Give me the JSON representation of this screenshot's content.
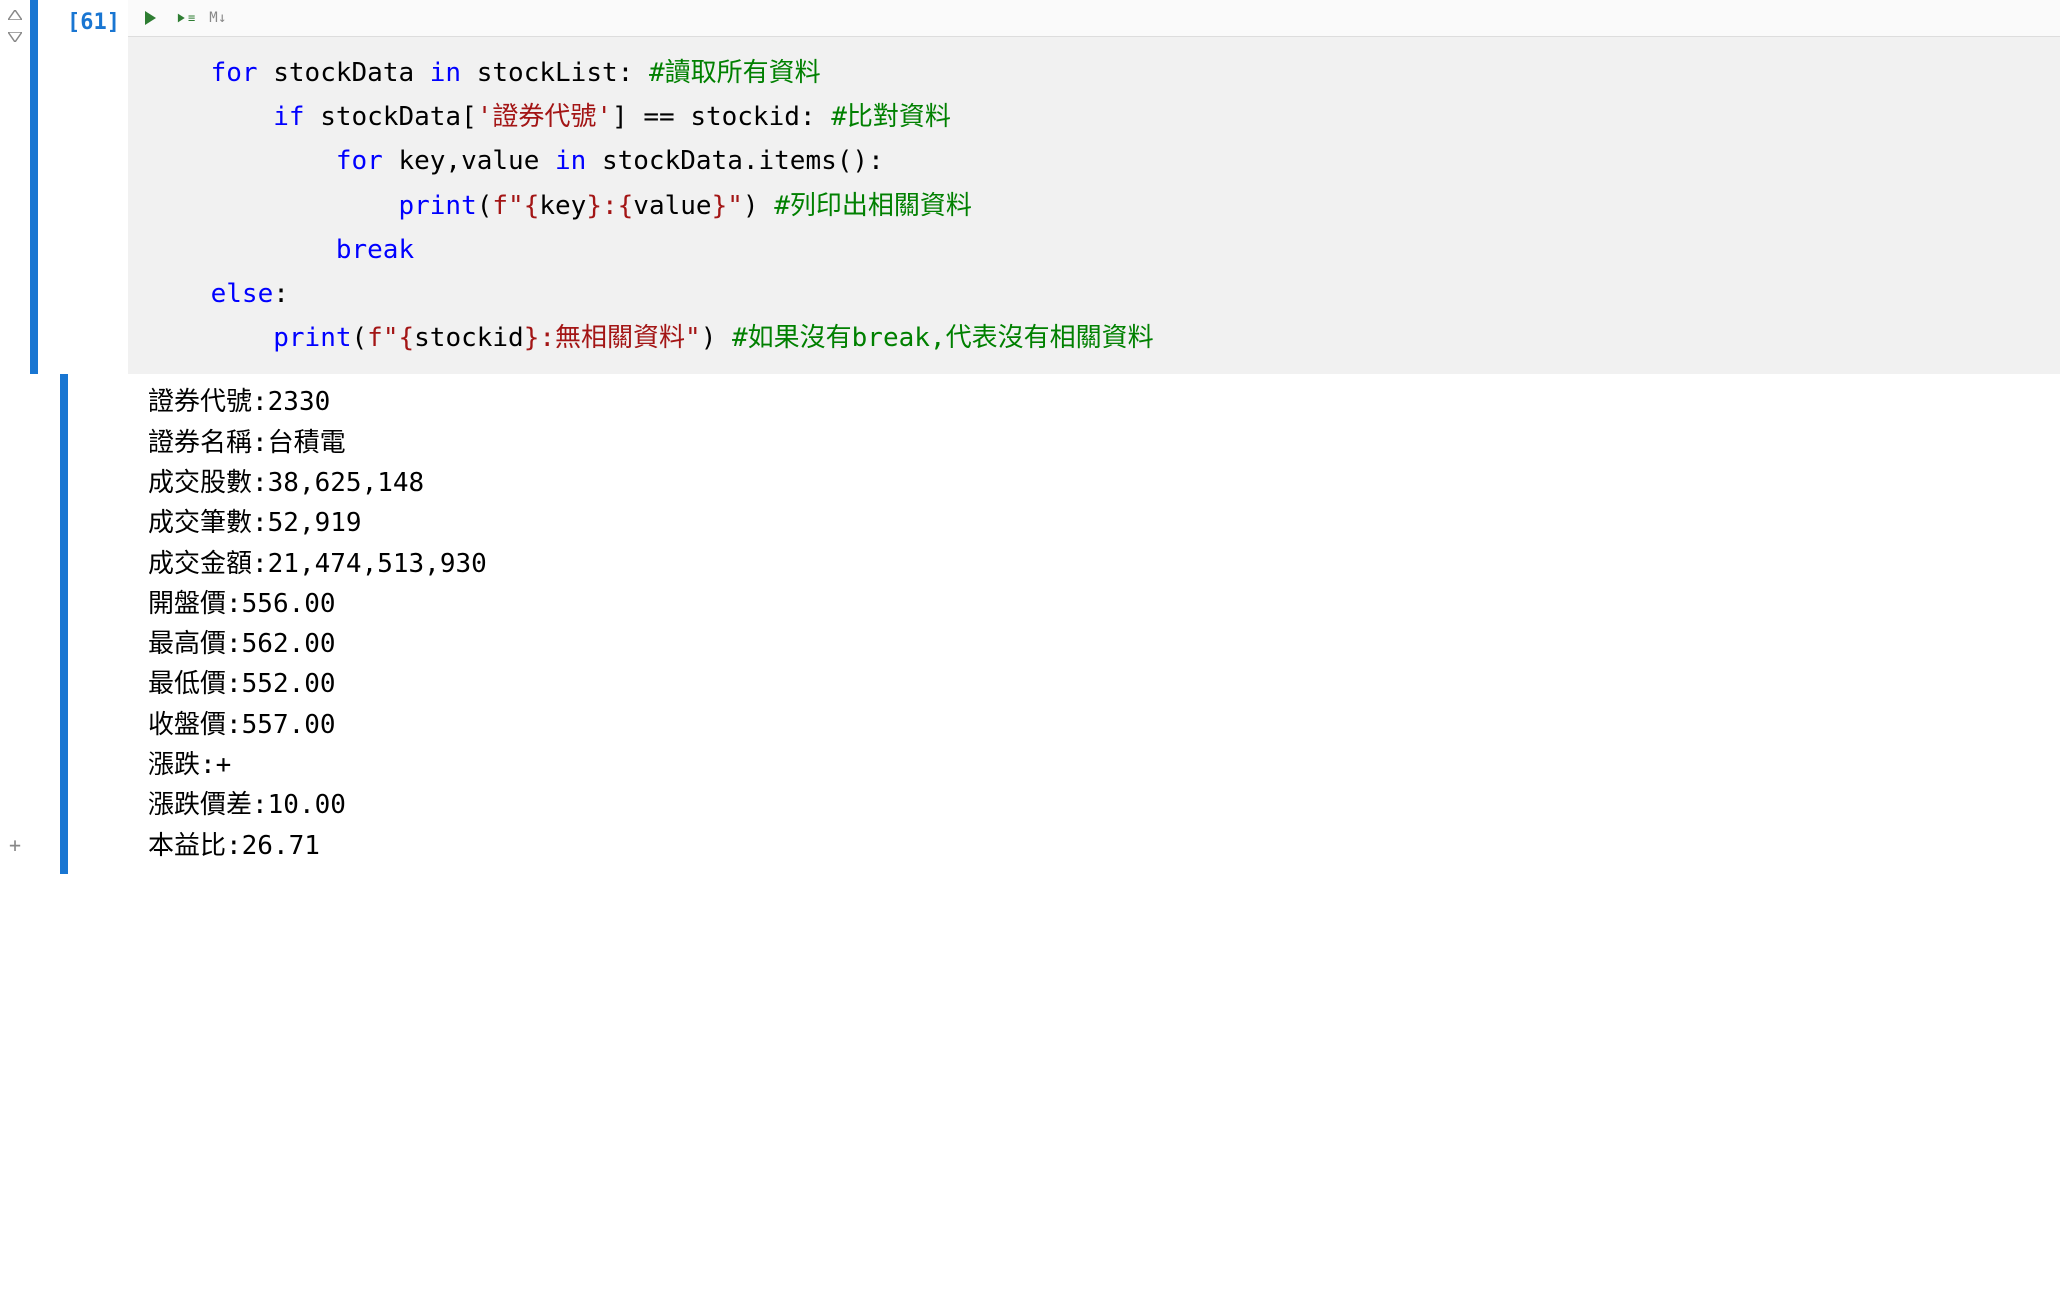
{
  "cell": {
    "execution_count_label": "[61]",
    "toolbar": {
      "run_title": "Run cell",
      "run_line_title": "Run line",
      "markdown_label": "M↓"
    },
    "code": {
      "line1_indent": "    ",
      "line1_for": "for",
      "line1_var": " stockData ",
      "line1_in": "in",
      "line1_rest": " stockList: ",
      "line1_cmt": "#讀取所有資料",
      "line2_indent": "        ",
      "line2_if": "if",
      "line2_a": " stockData[",
      "line2_str": "'證券代號'",
      "line2_b": "] == stockid: ",
      "line2_cmt": "#比對資料",
      "line3_indent": "            ",
      "line3_for": "for",
      "line3_a": " key,value ",
      "line3_in": "in",
      "line3_b": " stockData.items():",
      "line4_indent": "                ",
      "line4_print": "print",
      "line4_a": "(",
      "line4_f": "f\"",
      "line4_interp1_open": "{",
      "line4_interp1_id": "key",
      "line4_interp1_close": "}",
      "line4_colon": ":",
      "line4_interp2_open": "{",
      "line4_interp2_id": "value",
      "line4_interp2_close": "}",
      "line4_strend": "\"",
      "line4_b": ") ",
      "line4_cmt": "#列印出相關資料",
      "line5_indent": "            ",
      "line5_break": "break",
      "line6_indent": "    ",
      "line6_else": "else",
      "line6_colon": ":",
      "line7_indent": "        ",
      "line7_print": "print",
      "line7_a": "(",
      "line7_f": "f\"",
      "line7_interp_open": "{",
      "line7_interp_id": "stockid",
      "line7_interp_close": "}",
      "line7_text": ":無相關資料",
      "line7_strend": "\"",
      "line7_b": ") ",
      "line7_cmt": "#如果沒有break,代表沒有相關資料"
    }
  },
  "output": {
    "lines": [
      "證券代號:2330",
      "證券名稱:台積電",
      "成交股數:38,625,148",
      "成交筆數:52,919",
      "成交金額:21,474,513,930",
      "開盤價:556.00",
      "最高價:562.00",
      "最低價:552.00",
      "收盤價:557.00",
      "漲跌:+",
      "漲跌價差:10.00",
      "本益比:26.71"
    ]
  }
}
